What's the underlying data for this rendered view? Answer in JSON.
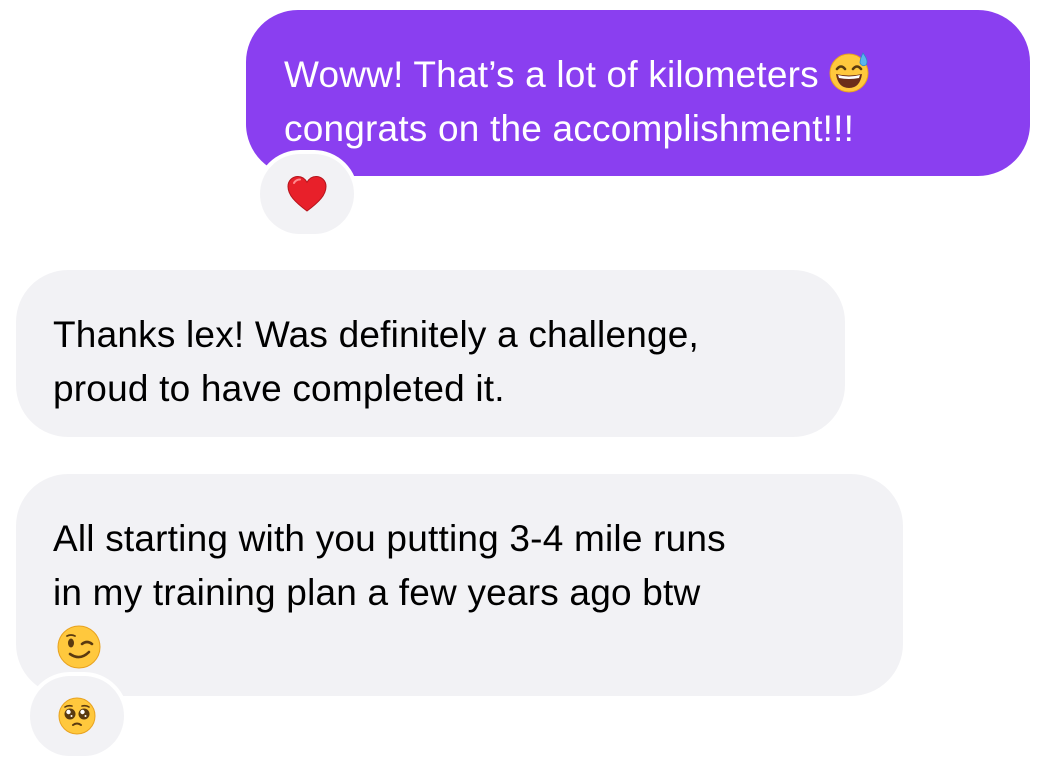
{
  "messages": [
    {
      "direction": "sent",
      "lines": [
        "Woww! That’s a lot of kilometers",
        "congrats on the accomplishment!!!"
      ],
      "inline_emoji": "grinning-face-with-sweat-emoji",
      "reaction": "red-heart-emoji"
    },
    {
      "direction": "received",
      "lines": [
        "Thanks lex! Was definitely a challenge,",
        "proud to have completed it."
      ]
    },
    {
      "direction": "received",
      "lines": [
        "All starting with you putting 3-4 mile runs",
        "in my training plan a few years ago btw"
      ],
      "trailing_emoji": "winking-face-emoji",
      "reaction": "pleading-face-emoji"
    }
  ],
  "colors": {
    "sent_bubble": "#8a3ff0",
    "received_bubble": "#f2f2f5",
    "sent_text": "#ffffff",
    "received_text": "#000000"
  }
}
